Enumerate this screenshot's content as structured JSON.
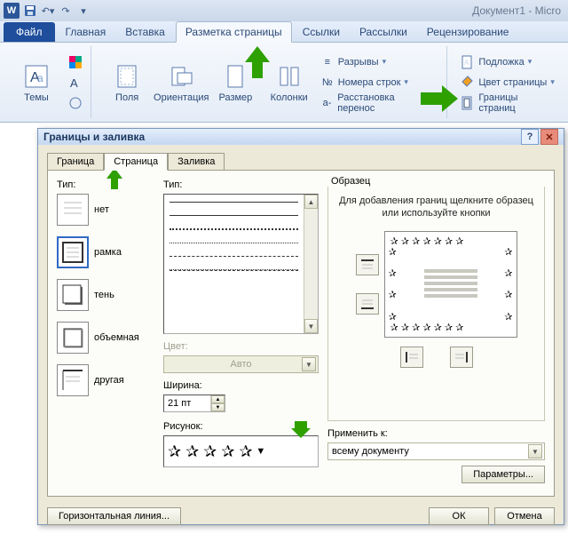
{
  "titlebar": {
    "doc": "Документ1 - Micro"
  },
  "tabs": {
    "file": "Файл",
    "home": "Главная",
    "insert": "Вставка",
    "layout": "Разметка страницы",
    "references": "Ссылки",
    "mailings": "Рассылки",
    "review": "Рецензирование"
  },
  "ribbon": {
    "themes": "Темы",
    "margins": "Поля",
    "orientation": "Ориентация",
    "size": "Размер",
    "columns": "Колонки",
    "breaks": "Разрывы",
    "line_numbers": "Номера строк",
    "hyphenation": "Расстановка перенос",
    "watermark": "Подложка",
    "page_color": "Цвет страницы",
    "page_borders": "Границы страниц"
  },
  "dialog": {
    "title": "Границы и заливка",
    "tabs": {
      "border": "Граница",
      "page": "Страница",
      "fill": "Заливка"
    },
    "type_label": "Тип:",
    "types": {
      "none": "нет",
      "box": "рамка",
      "shadow": "тень",
      "threeD": "объемная",
      "custom": "другая"
    },
    "style_label": "Тип:",
    "color_label": "Цвет:",
    "color_value": "Авто",
    "width_label": "Ширина:",
    "width_value": "21 пт",
    "art_label": "Рисунок:",
    "sample_label": "Образец",
    "sample_hint": "Для добавления границ щелкните образец или используйте кнопки",
    "apply_label": "Применить к:",
    "apply_value": "всему документу",
    "params": "Параметры...",
    "hline": "Горизонтальная линия...",
    "ok": "ОК",
    "cancel": "Отмена"
  }
}
